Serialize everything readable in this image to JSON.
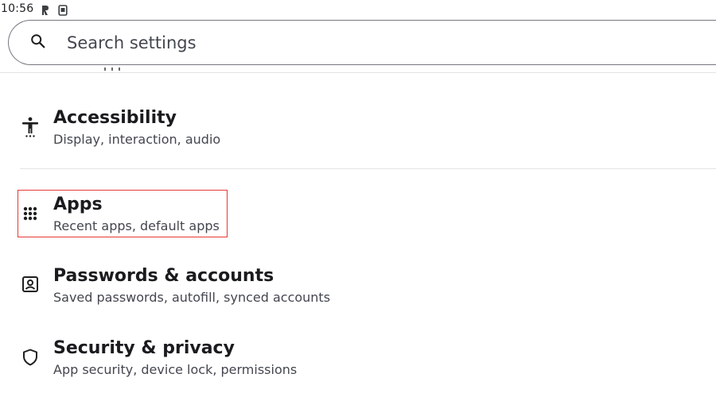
{
  "status_bar": {
    "time": "10:56",
    "icons": [
      "activity-icon",
      "screenshot-icon"
    ]
  },
  "search": {
    "placeholder": "Search settings",
    "icon": "search-icon"
  },
  "items": [
    {
      "title": "Accessibility",
      "subtitle": "Display, interaction, audio",
      "icon": "accessibility-icon"
    },
    {
      "title": "Apps",
      "subtitle": "Recent apps, default apps",
      "icon": "apps-grid-icon"
    },
    {
      "title": "Passwords & accounts",
      "subtitle": "Saved passwords, autofill, synced accounts",
      "icon": "account-box-icon"
    },
    {
      "title": "Security & privacy",
      "subtitle": "App security, device lock, permissions",
      "icon": "shield-icon"
    }
  ],
  "colors": {
    "highlight": "#e53935",
    "divider": "#e3e3e3",
    "title": "#1b1b1f",
    "subtitle": "#44474f"
  }
}
